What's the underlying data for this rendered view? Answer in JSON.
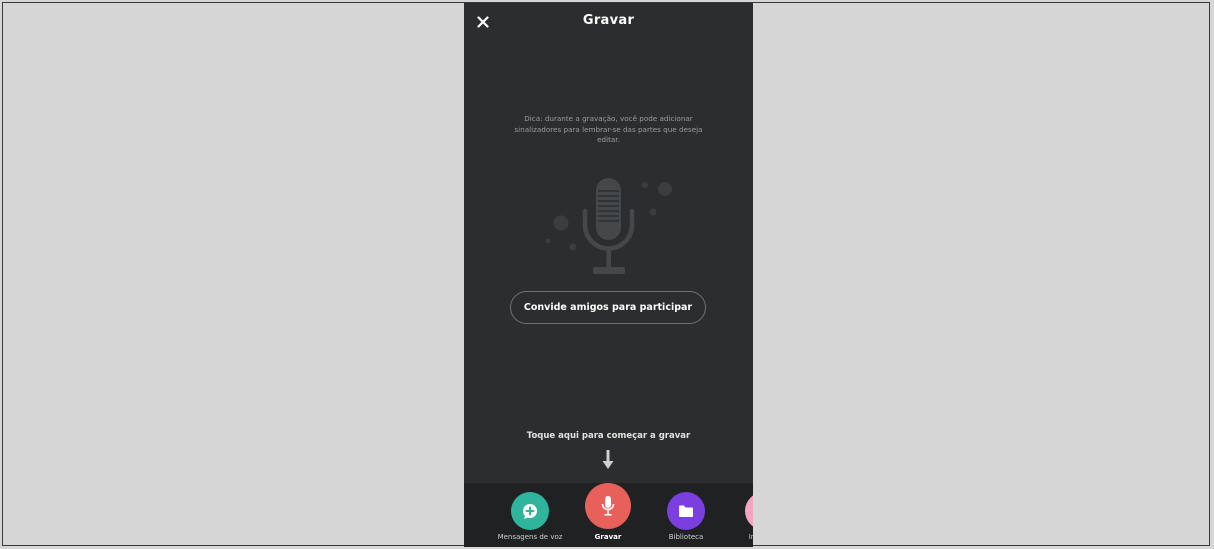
{
  "header": {
    "title": "Gravar",
    "close_icon": "close-icon"
  },
  "main": {
    "tip": "Dica: durante a gravação, você pode adicionar sinalizadores para lembrar-se das partes que deseja editar.",
    "illustration": "microphone-icon",
    "invite_label": "Convide amigos para participar",
    "hint": "Toque aqui para começar a gravar",
    "arrow": "arrow-down-icon"
  },
  "nav": {
    "items": [
      {
        "label": "Mensagens de voz",
        "icon": "voice-message-plus-icon",
        "color": "#2fb59b",
        "active": false
      },
      {
        "label": "Gravar",
        "icon": "microphone-icon",
        "color": "#e8605a",
        "active": true
      },
      {
        "label": "Biblioteca",
        "icon": "folder-icon",
        "color": "#7b3fe0",
        "active": false
      },
      {
        "label": "In",
        "icon": "interview-icon",
        "color": "#f3a6c3",
        "active": false
      }
    ]
  },
  "colors": {
    "background": "#2b2d2f",
    "nav_background": "#1f2123",
    "outer_background": "#d6d6d6"
  }
}
